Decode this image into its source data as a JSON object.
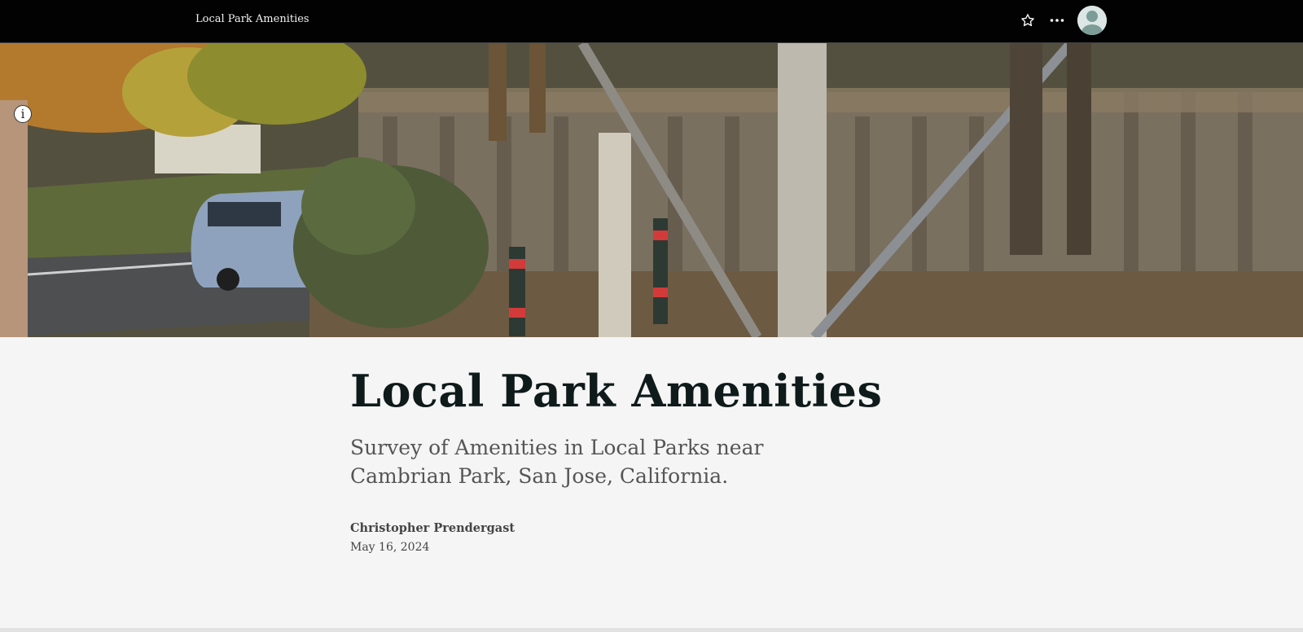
{
  "header": {
    "title": "Local Park Amenities",
    "star_icon": "star-icon",
    "more_icon": "more-horizontal-icon",
    "avatar_icon": "user-avatar-icon"
  },
  "hero": {
    "info_label": "i",
    "info_icon": "info-icon"
  },
  "article": {
    "title": "Local Park Amenities",
    "subtitle": "Survey of Amenities in Local Parks near Cambrian Park, San Jose, California.",
    "author": "Christopher Prendergast",
    "date": "May 16, 2024"
  },
  "colors": {
    "topbar_bg": "#020202",
    "page_bg": "#f5f5f5",
    "title_color": "#0f1a1a",
    "subtitle_color": "#555555"
  }
}
